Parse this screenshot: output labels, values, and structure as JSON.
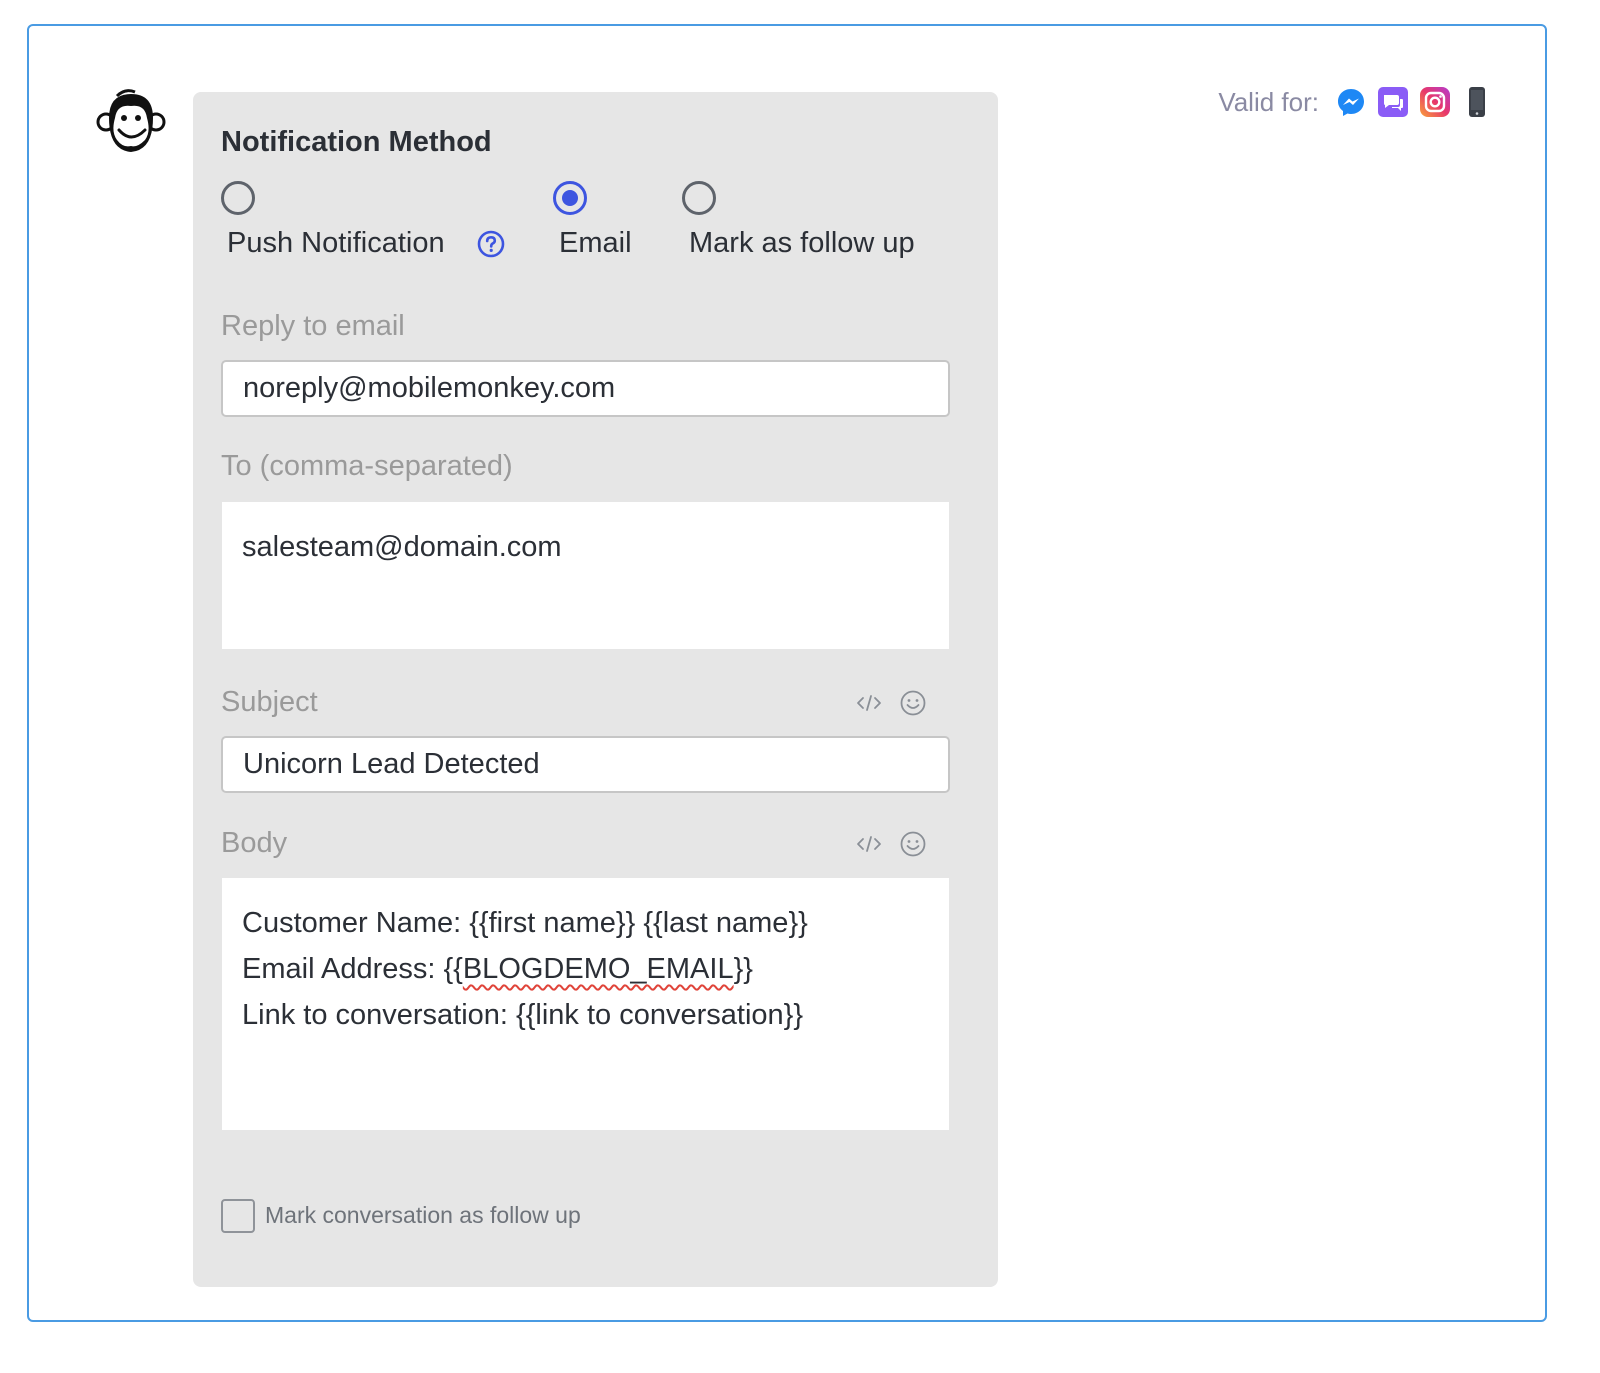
{
  "header": {
    "valid_for_label": "Valid for:",
    "channels": [
      "messenger-icon",
      "sms-chat-icon",
      "instagram-icon",
      "mobile-icon"
    ]
  },
  "notification": {
    "title": "Notification Method",
    "options": [
      {
        "label": "Push Notification",
        "checked": false
      },
      {
        "label": "Email",
        "checked": true
      },
      {
        "label": "Mark as follow up",
        "checked": false
      }
    ]
  },
  "form": {
    "reply_label": "Reply to email",
    "reply_value": "noreply@mobilemonkey.com",
    "to_label": "To (comma-separated)",
    "to_value": "salesteam@domain.com",
    "subject_label": "Subject",
    "subject_value": "Unicorn Lead Detected",
    "body_label": "Body",
    "body_lines": {
      "line1": "Customer Name: {{first name}} {{last name}}",
      "line2_prefix": "Email Address: {{",
      "line2_var": "BLOGDEMO_EMAIL",
      "line2_suffix": "}}",
      "line3": "Link to conversation: {{link to conversation}}"
    },
    "followup_checkbox_label": "Mark conversation as follow up",
    "followup_checked": false
  },
  "colors": {
    "accent": "#3d55e0",
    "border": "#4a9be3",
    "panel": "#e6e6e6"
  }
}
